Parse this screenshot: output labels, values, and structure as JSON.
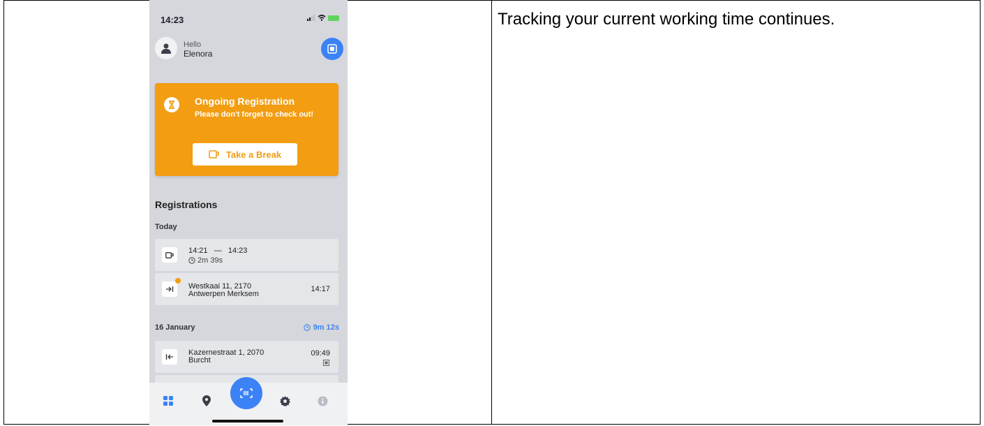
{
  "caption": "Tracking your current working time continues.",
  "status_bar": {
    "time": "14:23"
  },
  "header": {
    "greeting": "Hello",
    "user_name": "Elenora"
  },
  "card": {
    "title": "Ongoing Registration",
    "subtitle": "Please don't forget to check out!",
    "break_button": "Take a Break",
    "color": "#f29d12"
  },
  "registrations": {
    "title": "Registrations",
    "groups": [
      {
        "label": "Today",
        "rows": [
          {
            "icon": "coffee-cup-icon",
            "start": "14:21",
            "dash": "—",
            "end": "14:23",
            "duration": "2m 39s"
          },
          {
            "icon": "check-in-icon",
            "address_line1": "Westkaai 11, 2170",
            "address_line2": "Antwerpen Merksem",
            "time": "14:17"
          }
        ]
      },
      {
        "label": "16 January",
        "total": "9m 12s",
        "rows": [
          {
            "icon": "check-out-icon",
            "address_line1": "Kazernestraat 1, 2070",
            "address_line2": "Burcht",
            "time": "09:49"
          }
        ]
      }
    ]
  },
  "tabbar": {
    "items": [
      "dashboard-icon",
      "location-pin-icon",
      "scan-icon",
      "gear-icon",
      "info-icon"
    ]
  },
  "accent": "#3b82f6"
}
